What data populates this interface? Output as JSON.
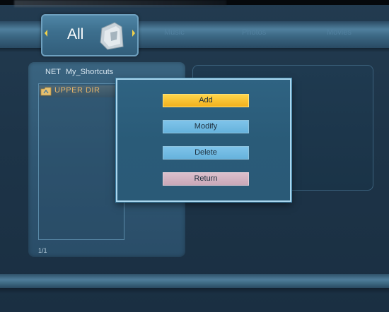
{
  "tabs": {
    "active": {
      "label": "All",
      "icon": "folder-icon"
    },
    "inactive": [
      {
        "label": "Music"
      },
      {
        "label": "Photos"
      },
      {
        "label": "Movies"
      }
    ]
  },
  "browser": {
    "source_label": "NET",
    "folder_label": "My_Shortcuts",
    "items": [
      {
        "label": "UPPER DIR",
        "icon": "folder-up-icon"
      }
    ],
    "page_indicator": "1/1"
  },
  "dialog": {
    "buttons": [
      {
        "label": "Add",
        "state": "selected"
      },
      {
        "label": "Modify",
        "state": "normal"
      },
      {
        "label": "Delete",
        "state": "normal"
      },
      {
        "label": "Return",
        "state": "normal"
      }
    ]
  },
  "colors": {
    "background": "#1d3448",
    "selected_button": "#f2b11d",
    "normal_button": "#66b2dc",
    "return_button": "#c9a8b8",
    "dialog_border": "#a9d6ee"
  }
}
